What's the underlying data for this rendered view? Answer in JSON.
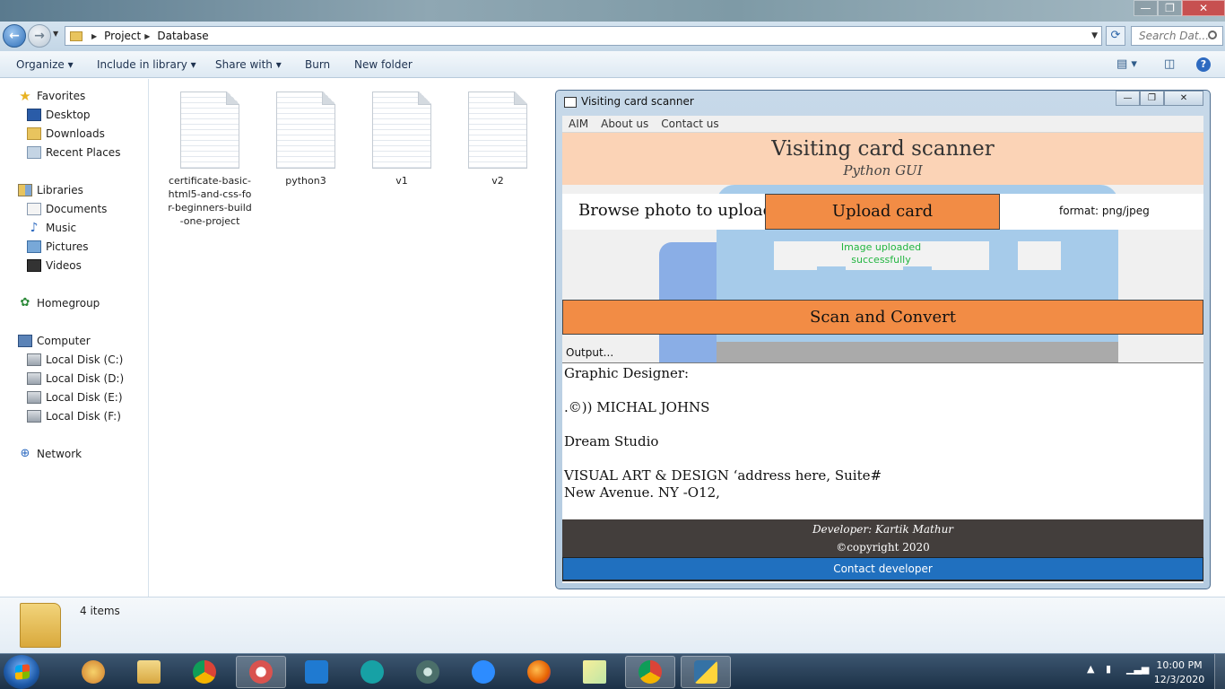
{
  "explorer": {
    "window_controls": {
      "minimize": "—",
      "maximize": "❐",
      "close": "✕"
    },
    "breadcrumb": [
      "Project",
      "Database"
    ],
    "search_placeholder": "Search Dat...",
    "toolbar": {
      "organize": "Organize ▾",
      "include_in_library": "Include in library ▾",
      "share_with": "Share with ▾",
      "burn": "Burn",
      "new_folder": "New folder"
    },
    "nav": {
      "favorites": "Favorites",
      "desktop": "Desktop",
      "downloads": "Downloads",
      "recent_places": "Recent Places",
      "libraries": "Libraries",
      "documents": "Documents",
      "music": "Music",
      "pictures": "Pictures",
      "videos": "Videos",
      "homegroup": "Homegroup",
      "computer": "Computer",
      "disk_c": "Local Disk (C:)",
      "disk_d": "Local Disk (D:)",
      "disk_e": "Local Disk (E:)",
      "disk_f": "Local Disk (F:)",
      "network": "Network"
    },
    "files": [
      {
        "name": "certificate-basic-html5-and-css-for-beginners-build-one-project"
      },
      {
        "name": "python3"
      },
      {
        "name": "v1"
      },
      {
        "name": "v2"
      }
    ],
    "status": "4 items"
  },
  "app": {
    "title": "Visiting card scanner",
    "menu": [
      "AIM",
      "About us",
      "Contact us"
    ],
    "heading": "Visiting card scanner",
    "subheading": "Python GUI",
    "browse_label": "Browse photo to upload",
    "upload_button": "Upload card",
    "format_label": "format: png/jpeg",
    "status_message": "Image uploaded successfully",
    "scan_button": "Scan and Convert",
    "output_label": "Output...",
    "output_lines": [
      "Graphic Designer:",
      "",
      ".©)) MICHAL JOHNS",
      "",
      "Dream Studio",
      "",
      "VISUAL ART & DESIGN ‘address here, Suite#",
      "New Avenue. NY -O12,"
    ],
    "footer_developer": "Developer: Kartik Mathur",
    "footer_copyright": "©copyright 2020",
    "contact_button": "Contact developer",
    "colors": {
      "header_bg": "#fbd3b6",
      "button_orange": "#f28c45",
      "footer_bg": "#433e3c",
      "contact_blue": "#2070bf",
      "success_green": "#22b540"
    }
  },
  "taskbar": {
    "apps": [
      "paint-icon",
      "explorer-icon",
      "chrome-icon",
      "snipping-icon",
      "vscode-icon",
      "arduino-icon",
      "atom-icon",
      "zoom-icon",
      "firefox-icon",
      "sticky-notes-icon",
      "chrome-icon",
      "python-icon"
    ],
    "time": "10:00 PM",
    "date": "12/3/2020"
  }
}
